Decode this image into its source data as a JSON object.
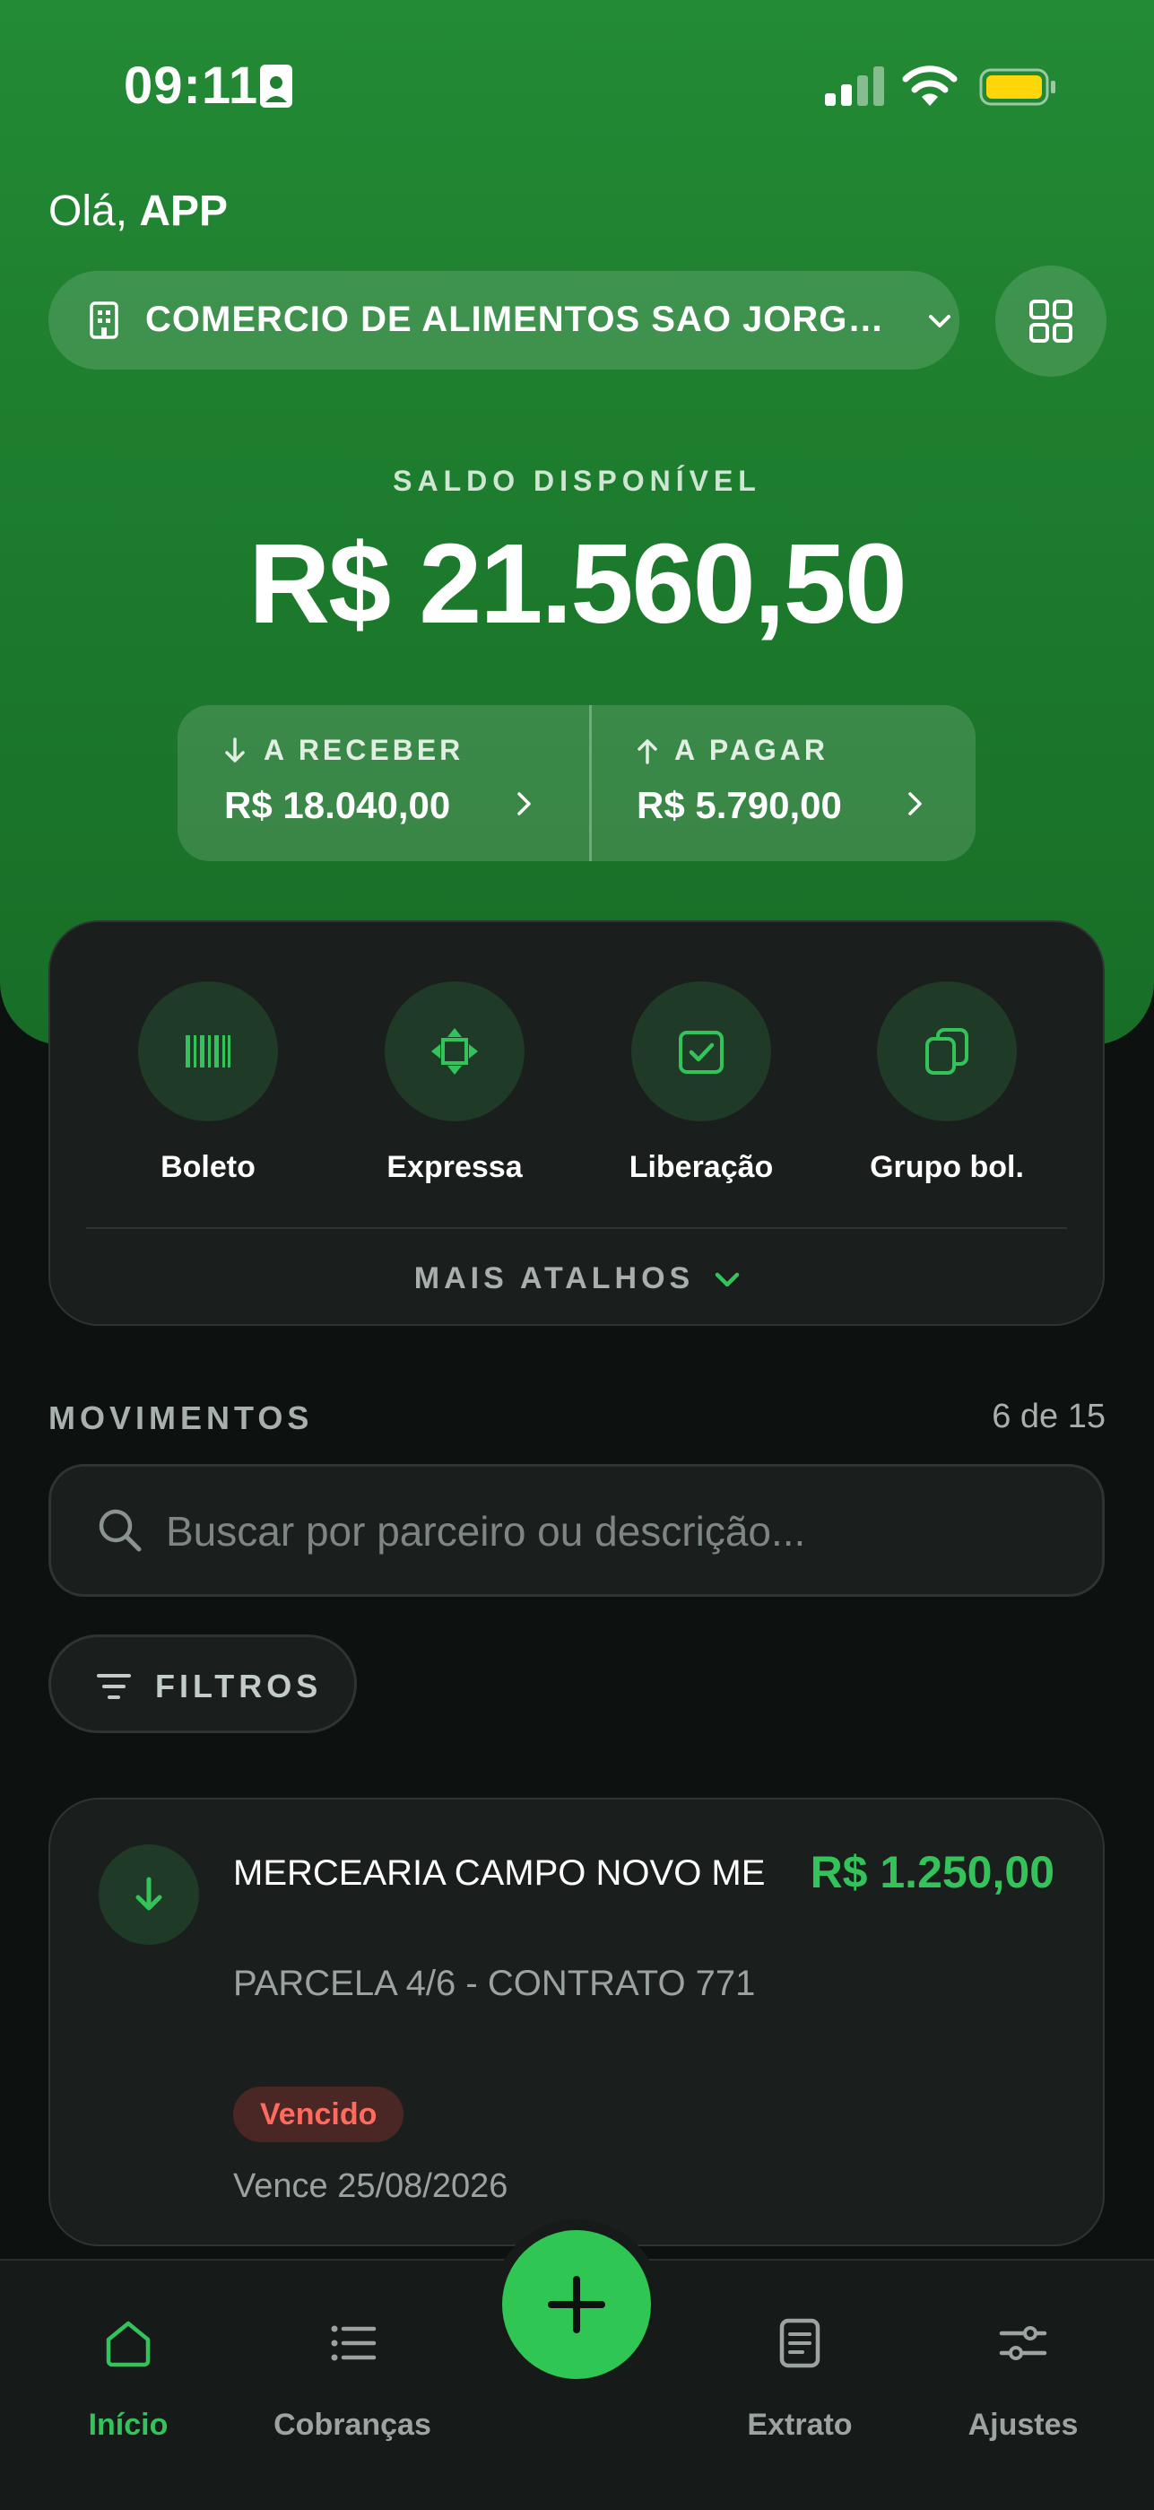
{
  "status_bar": {
    "time": "09:11"
  },
  "header": {
    "greeting_prefix": "Olá,",
    "greeting_name": "APP",
    "company_name": "COMERCIO DE ALIMENTOS SAO JORG…",
    "balance_label": "SALDO DISPONÍVEL",
    "balance_value": "R$ 21.560,50",
    "receivable": {
      "label": "A RECEBER",
      "value": "R$ 18.040,00"
    },
    "payable": {
      "label": "A PAGAR",
      "value": "R$ 5.790,00"
    }
  },
  "shortcuts": {
    "items": [
      {
        "label": "Boleto",
        "icon": "barcode-icon"
      },
      {
        "label": "Expressa",
        "icon": "diamond-arrows-icon"
      },
      {
        "label": "Liberação",
        "icon": "check-square-icon"
      },
      {
        "label": "Grupo bol.",
        "icon": "copy-icon"
      }
    ],
    "more_label": "MAIS ATALHOS"
  },
  "movements": {
    "title": "MOVIMENTOS",
    "count": "6 de 15",
    "search_placeholder": "Buscar por parceiro ou descrição...",
    "filters_label": "FILTROS",
    "items": [
      {
        "partner": "MERCEARIA CAMPO NOVO ME",
        "description": "PARCELA 4/6 - CONTRATO 771",
        "amount": "R$ 1.250,00",
        "status": "Vencido",
        "due": "Vence 25/08/2026",
        "direction": "incoming"
      }
    ]
  },
  "tabbar": {
    "items": [
      {
        "label": "Início",
        "icon": "home-icon",
        "active": true
      },
      {
        "label": "Cobranças",
        "icon": "list-icon",
        "active": false
      },
      {
        "label": "Extrato",
        "icon": "document-icon",
        "active": false
      },
      {
        "label": "Ajustes",
        "icon": "sliders-icon",
        "active": false
      }
    ],
    "fab_icon": "plus-icon"
  },
  "colors": {
    "header_green": "#1f8030",
    "accent_green": "#33c35a",
    "background": "#0d1110",
    "card": "#1a1e1c",
    "overdue_red": "#ff6b5e",
    "battery_yellow": "#ffd60a"
  }
}
